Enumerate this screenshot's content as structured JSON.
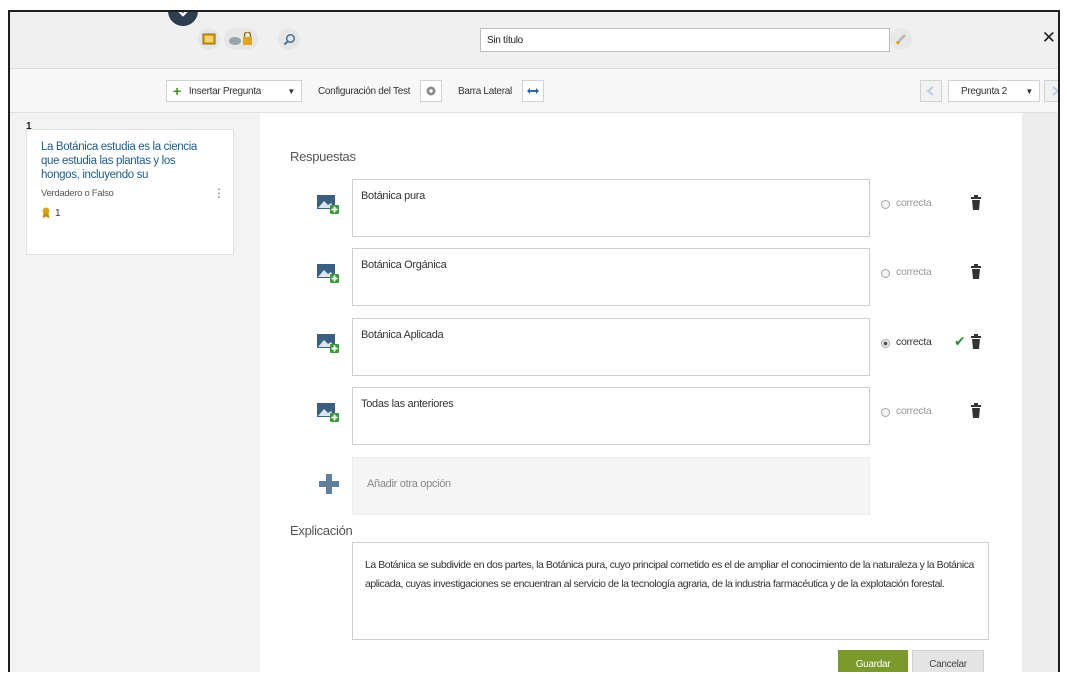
{
  "topbar": {
    "title_value": "Sin título",
    "icons": [
      "chevron-down-icon",
      "book-icon",
      "cloud-lock-icon",
      "magnifier-icon",
      "brush-icon",
      "close-icon"
    ]
  },
  "toolbar": {
    "insert_question": "Insertar Pregunta",
    "test_config": "Configuración del Test",
    "sidebar_toggle": "Barra Lateral",
    "question_selector": "Pregunta 2"
  },
  "sidebar": {
    "question_number": "1",
    "question_text": "La Botánica estudia es la ciencia que estudia las plantas y los hongos, incluyendo su",
    "question_type": "Verdadero o Falso",
    "points": "1"
  },
  "main": {
    "answers_label": "Respuestas",
    "answers": [
      {
        "text": "Botánica pura",
        "correct_label": "correcta",
        "is_correct": false
      },
      {
        "text": "Botánica Orgánica",
        "correct_label": "correcta",
        "is_correct": false
      },
      {
        "text": "Botánica Aplicada",
        "correct_label": "correcta",
        "is_correct": true
      },
      {
        "text": "Todas las anteriores",
        "correct_label": "correcta",
        "is_correct": false
      }
    ],
    "add_option_label": "Añadir otra opción",
    "explanation_label": "Explicación",
    "explanation_text": "La Botánica se subdivide en dos partes, la Botánica pura, cuyo principal cometido es el de ampliar el conocimiento de la naturaleza y la Botánica aplicada, cuyas investigaciones se encuentran al servicio de la tecnología agraria, de la industria farmacéutica y de la explotación forestal.",
    "save_label": "Guardar",
    "cancel_label": "Cancelar"
  },
  "colors": {
    "accent_green": "#7c9a2b",
    "link_blue": "#1f5c88",
    "badge_navy": "#2d3e50"
  }
}
